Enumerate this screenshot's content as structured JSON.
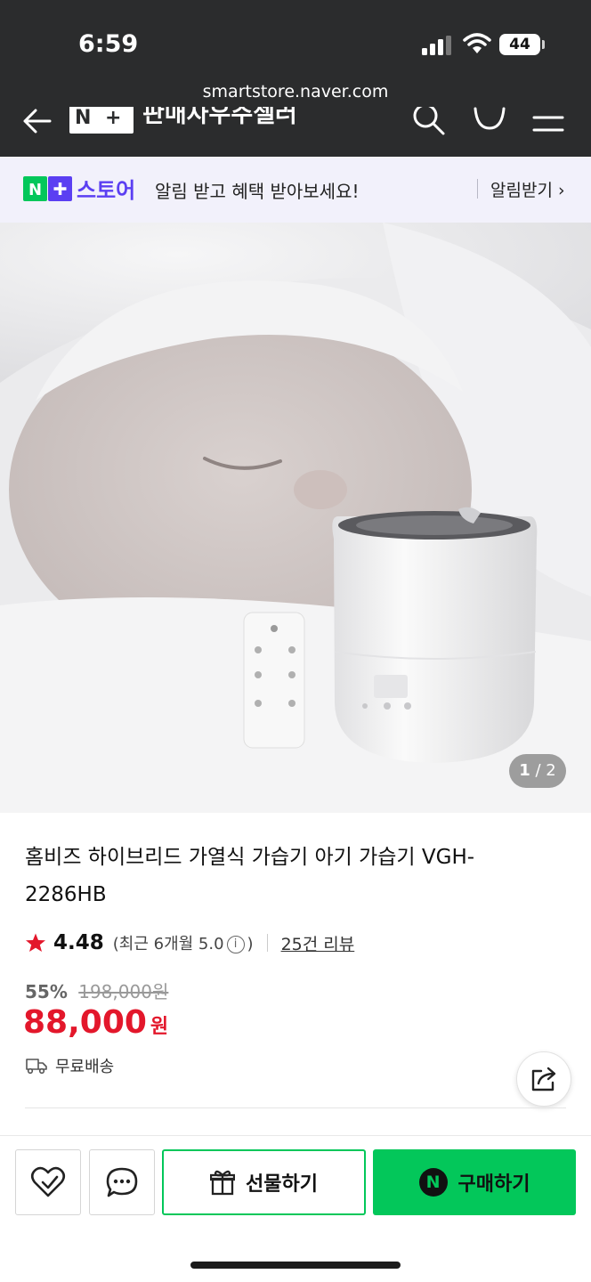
{
  "status_bar": {
    "time": "6:59",
    "battery": "44"
  },
  "browser": {
    "url": "smartstore.naver.com"
  },
  "nav": {
    "store_name": "판매자우주셀러"
  },
  "promo": {
    "store_label": "스토어",
    "message": "알림 받고 혜택 받아보세요!",
    "action": "알림받기 ›"
  },
  "gallery": {
    "current": "1",
    "total": "/ 2"
  },
  "product": {
    "title": "홈비즈 하이브리드 가열식 가습기 아기 가습기 VGH-2286HB",
    "rating": "4.48",
    "recent_rating_prefix": "(최근 6개월 5.0",
    "recent_rating_suffix": ")",
    "reviews": "25건 리뷰",
    "discount_rate": "55%",
    "original_price": "198,000원",
    "price": "88,000",
    "currency": "원",
    "shipping": "무료배송"
  },
  "actions": {
    "gift_label": "선물하기",
    "buy_label": "구매하기"
  },
  "colors": {
    "naver_green": "#03c75a",
    "price_red": "#e3172b",
    "store_purple": "#5b3ff2"
  }
}
